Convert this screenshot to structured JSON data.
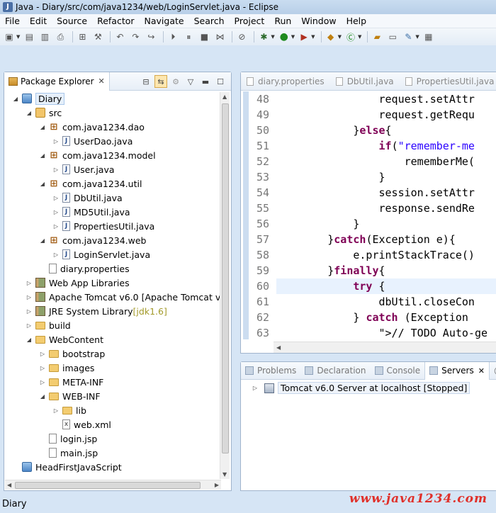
{
  "window": {
    "title": "Java - Diary/src/com/java1234/web/LoginServlet.java - Eclipse"
  },
  "menu": [
    "File",
    "Edit",
    "Source",
    "Refactor",
    "Navigate",
    "Search",
    "Project",
    "Run",
    "Window",
    "Help"
  ],
  "package_explorer": {
    "tab_label": "Package Explorer",
    "tree": [
      {
        "label": "Diary",
        "icon": "project-icon",
        "twisty": "open",
        "selected": true
      },
      {
        "label": "src",
        "icon": "source-folder-icon",
        "twisty": "open"
      },
      {
        "label": "com.java1234.dao",
        "icon": "package-icon",
        "twisty": "open"
      },
      {
        "label": "UserDao.java",
        "icon": "java-file-icon",
        "twisty": "closed"
      },
      {
        "label": "com.java1234.model",
        "icon": "package-icon",
        "twisty": "open"
      },
      {
        "label": "User.java",
        "icon": "java-file-icon",
        "twisty": "closed"
      },
      {
        "label": "com.java1234.util",
        "icon": "package-icon",
        "twisty": "open"
      },
      {
        "label": "DbUtil.java",
        "icon": "java-file-icon",
        "twisty": "closed"
      },
      {
        "label": "MD5Util.java",
        "icon": "java-file-icon",
        "twisty": "closed"
      },
      {
        "label": "PropertiesUtil.java",
        "icon": "java-file-icon",
        "twisty": "closed"
      },
      {
        "label": "com.java1234.web",
        "icon": "package-icon",
        "twisty": "open"
      },
      {
        "label": "LoginServlet.java",
        "icon": "java-file-icon",
        "twisty": "closed"
      },
      {
        "label": "diary.properties",
        "icon": "file-icon",
        "twisty": "none"
      },
      {
        "label": "Web App Libraries",
        "icon": "library-icon",
        "twisty": "closed"
      },
      {
        "label": "Apache Tomcat v6.0 [Apache Tomcat v6",
        "icon": "library-icon",
        "twisty": "closed"
      },
      {
        "label": "JRE System Library",
        "decor": "[jdk1.6]",
        "icon": "library-icon",
        "twisty": "closed"
      },
      {
        "label": "build",
        "icon": "folder-icon",
        "twisty": "closed"
      },
      {
        "label": "WebContent",
        "icon": "folder-icon",
        "twisty": "open"
      },
      {
        "label": "bootstrap",
        "icon": "folder-icon",
        "twisty": "closed"
      },
      {
        "label": "images",
        "icon": "folder-icon",
        "twisty": "closed"
      },
      {
        "label": "META-INF",
        "icon": "folder-icon",
        "twisty": "closed"
      },
      {
        "label": "WEB-INF",
        "icon": "folder-icon",
        "twisty": "open"
      },
      {
        "label": "lib",
        "icon": "folder-icon",
        "twisty": "closed"
      },
      {
        "label": "web.xml",
        "icon": "xml-file-icon",
        "twisty": "none"
      },
      {
        "label": "login.jsp",
        "icon": "file-icon",
        "twisty": "none"
      },
      {
        "label": "main.jsp",
        "icon": "file-icon",
        "twisty": "none"
      },
      {
        "label": "HeadFirstJavaScript",
        "icon": "project-icon",
        "twisty": "none"
      }
    ]
  },
  "editor": {
    "tabs": [
      "diary.properties",
      "DbUtil.java",
      "PropertiesUtil.java"
    ],
    "lines": [
      {
        "num": "48",
        "html": "                request.setAttr"
      },
      {
        "num": "49",
        "html": "                request.getRequ"
      },
      {
        "num": "50",
        "html": "            }else{"
      },
      {
        "num": "51",
        "html": "                if(\"remember-me"
      },
      {
        "num": "52",
        "html": "                    rememberMe("
      },
      {
        "num": "53",
        "html": "                }"
      },
      {
        "num": "54",
        "html": "                session.setAttr"
      },
      {
        "num": "55",
        "html": "                response.sendRe"
      },
      {
        "num": "56",
        "html": "            }"
      },
      {
        "num": "57",
        "html": "        }catch(Exception e){"
      },
      {
        "num": "58",
        "html": "            e.printStackTrace()"
      },
      {
        "num": "59",
        "html": "        }finally{"
      },
      {
        "num": "60",
        "html": "            try {"
      },
      {
        "num": "61",
        "html": "                dbUtil.closeCon"
      },
      {
        "num": "62",
        "html": "            } catch (Exception "
      },
      {
        "num": "63",
        "html": "                // TODO Auto-ge"
      }
    ]
  },
  "bottom_views": {
    "tabs": [
      "Problems",
      "Declaration",
      "Console",
      "Servers",
      "Ja"
    ],
    "active": "Servers",
    "server": "Tomcat v6.0 Server at localhost",
    "server_state": "[Stopped]"
  },
  "status_bar": {
    "text": "Diary"
  },
  "watermark": {
    "text": "www.java1234.com"
  }
}
